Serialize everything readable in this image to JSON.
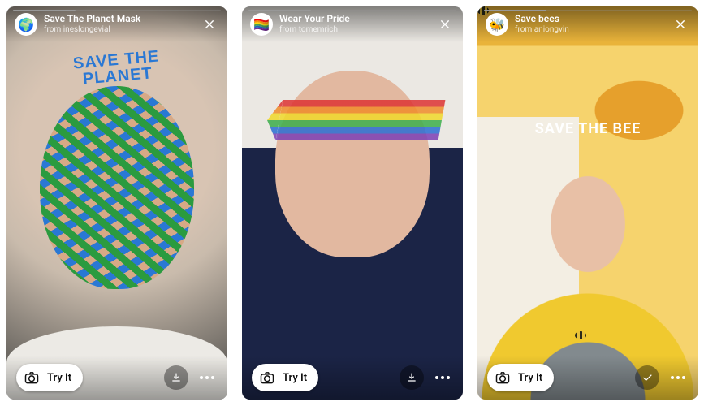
{
  "stories": [
    {
      "filter_name": "Save The Planet Mask",
      "creator_prefix": "from",
      "creator": "ineslongevial",
      "avatar_emoji": "🌍",
      "overlay_text": "SAVE\nTHE PLANET",
      "try_label": "Try It",
      "secondary_action": "save"
    },
    {
      "filter_name": "Wear Your Pride",
      "creator_prefix": "from",
      "creator": "tomemrich",
      "avatar_emoji": "🏳️‍🌈",
      "overlay_text": "",
      "try_label": "Try It",
      "secondary_action": "save"
    },
    {
      "filter_name": "Save bees",
      "creator_prefix": "from",
      "creator": "aniongvin",
      "avatar_emoji": "🐝",
      "overlay_text": "SAVE THE BEE",
      "try_label": "Try It",
      "secondary_action": "saved"
    }
  ]
}
